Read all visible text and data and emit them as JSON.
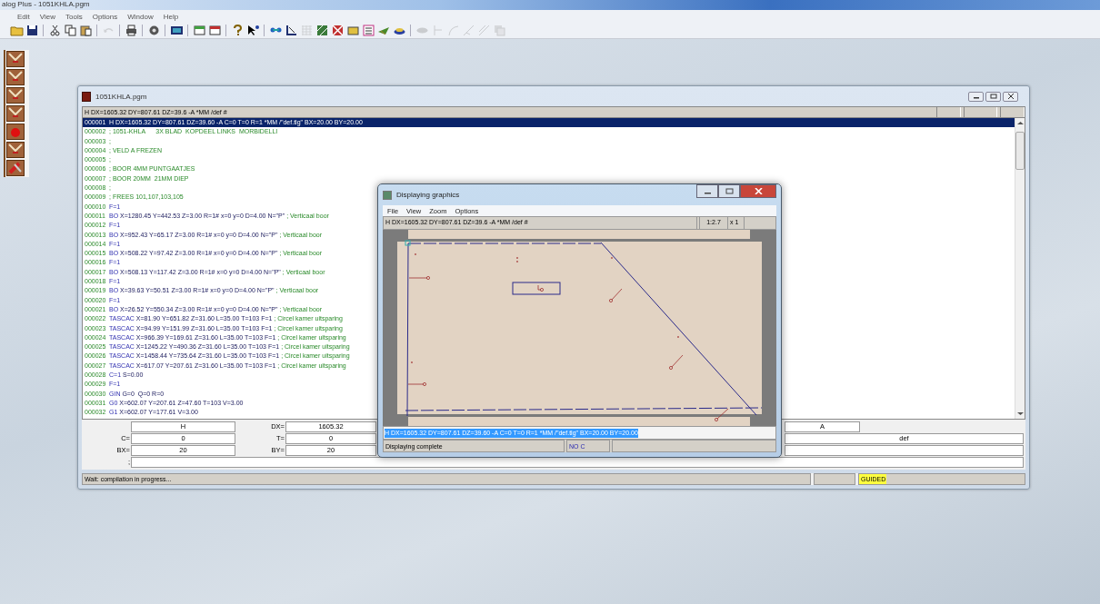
{
  "app": {
    "title": "alog Plus - 1051KHLA.pgm"
  },
  "menu": [
    "Edit",
    "View",
    "Tools",
    "Options",
    "Window",
    "Help"
  ],
  "toolbar": [
    [
      {
        "disabled": false
      },
      {
        "disabled": false
      }
    ],
    [
      {
        "disabled": false
      },
      {
        "disabled": false
      },
      {
        "disabled": false
      }
    ],
    [
      {
        "disabled": true
      }
    ],
    [
      {
        "disabled": false
      }
    ],
    [
      {
        "disabled": false
      }
    ],
    [
      {
        "disabled": false
      }
    ],
    [
      {
        "disabled": false
      },
      {
        "disabled": false
      }
    ],
    [
      {
        "disabled": false
      },
      {
        "disabled": false
      }
    ],
    [
      {
        "disabled": false
      },
      {
        "disabled": false
      },
      {
        "disabled": true
      },
      {
        "disabled": false
      },
      {
        "disabled": false
      },
      {
        "disabled": false
      },
      {
        "disabled": false
      },
      {
        "disabled": false
      },
      {
        "disabled": false
      }
    ],
    [
      {
        "disabled": true
      },
      {
        "disabled": true
      },
      {
        "disabled": true
      },
      {
        "disabled": true
      },
      {
        "disabled": true
      },
      {
        "disabled": true
      }
    ]
  ],
  "side_tools": [
    {
      "kind": "chevron"
    },
    {
      "kind": "chevron"
    },
    {
      "kind": "chevron"
    },
    {
      "kind": "chevron"
    },
    {
      "kind": "dot"
    },
    {
      "kind": "chevron"
    },
    {
      "kind": "tools"
    }
  ],
  "editor": {
    "title": "1051KHLA.pgm",
    "header": "H DX=1605.32 DY=807.61 DZ=39.6 -A *MM /def #",
    "lines": [
      {
        "number": "000001",
        "keyword": "H",
        "args": "DX=1605.32 DY=807.61 DZ=39.60 -A C=0 T=0 R=1 *MM /\"def.tlg\" BX=20.00 BY=20.00",
        "selected": true
      },
      {
        "number": "000002",
        "comment": "; 1051-KHLA      3X BLAD  KOPDEEL LINKS  MORBIDELLI",
        "selected": false
      },
      {
        "number": "000003",
        "comment": ";",
        "selected": false
      },
      {
        "number": "000004",
        "comment": "; VELD A FREZEN",
        "selected": false
      },
      {
        "number": "000005",
        "comment": ";",
        "selected": false
      },
      {
        "number": "000006",
        "comment": "; BOOR 4MM PUNTGAATJES",
        "selected": false
      },
      {
        "number": "000007",
        "comment": "; BOOR 20MM  21MM DIEP",
        "selected": false
      },
      {
        "number": "000008",
        "comment": ";",
        "selected": false
      },
      {
        "number": "000009",
        "comment": "; FREES 101,107,103,105",
        "selected": false
      },
      {
        "number": "000010",
        "keyword": "F=1",
        "selected": false
      },
      {
        "number": "000011",
        "keyword": "BO",
        "args": "X=1280.45 Y=442.53 Z=3.00 R=1# x=0 y=0 D=4.00 N=\"P\"",
        "comment": "; Verticaal boor",
        "selected": false
      },
      {
        "number": "000012",
        "keyword": "F=1",
        "selected": false
      },
      {
        "number": "000013",
        "keyword": "BO",
        "args": "X=952.43 Y=65.17 Z=3.00 R=1# x=0 y=0 D=4.00 N=\"P\"",
        "comment": "; Verticaal boor",
        "selected": false
      },
      {
        "number": "000014",
        "keyword": "F=1",
        "selected": false
      },
      {
        "number": "000015",
        "keyword": "BO",
        "args": "X=508.22 Y=97.42 Z=3.00 R=1# x=0 y=0 D=4.00 N=\"P\"",
        "comment": "; Verticaal boor",
        "selected": false
      },
      {
        "number": "000016",
        "keyword": "F=1",
        "selected": false
      },
      {
        "number": "000017",
        "keyword": "BO",
        "args": "X=508.13 Y=117.42 Z=3.00 R=1# x=0 y=0 D=4.00 N=\"P\"",
        "comment": "; Verticaal boor",
        "selected": false
      },
      {
        "number": "000018",
        "keyword": "F=1",
        "selected": false
      },
      {
        "number": "000019",
        "keyword": "BO",
        "args": "X=39.63 Y=50.51 Z=3.00 R=1# x=0 y=0 D=4.00 N=\"P\"",
        "comment": "; Verticaal boor",
        "selected": false
      },
      {
        "number": "000020",
        "keyword": "F=1",
        "selected": false
      },
      {
        "number": "000021",
        "keyword": "BO",
        "args": "X=26.52 Y=550.34 Z=3.00 R=1# x=0 y=0 D=4.00 N=\"P\"",
        "comment": "; Verticaal boor",
        "selected": false
      },
      {
        "number": "000022",
        "keyword": "TASCAC",
        "args": "X=81.90 Y=651.82 Z=31.60 L=35.00 T=103 F=1",
        "comment": "; Circel kamer uitsparing",
        "selected": false
      },
      {
        "number": "000023",
        "keyword": "TASCAC",
        "args": "X=94.99 Y=151.99 Z=31.60 L=35.00 T=103 F=1",
        "comment": "; Circel kamer uitsparing",
        "selected": false
      },
      {
        "number": "000024",
        "keyword": "TASCAC",
        "args": "X=966.39 Y=169.61 Z=31.60 L=35.00 T=103 F=1",
        "comment": "; Circel kamer uitsparing",
        "selected": false
      },
      {
        "number": "000025",
        "keyword": "TASCAC",
        "args": "X=1245.22 Y=490.36 Z=31.60 L=35.00 T=103 F=1",
        "comment": "; Circel kamer uitsparing",
        "selected": false
      },
      {
        "number": "000026",
        "keyword": "TASCAC",
        "args": "X=1458.44 Y=735.64 Z=31.60 L=35.00 T=103 F=1",
        "comment": "; Circel kamer uitsparing",
        "selected": false
      },
      {
        "number": "000027",
        "keyword": "TASCAC",
        "args": "X=617.07 Y=207.61 Z=31.60 L=35.00 T=103 F=1",
        "comment": "; Circel kamer uitsparing",
        "selected": false
      },
      {
        "number": "000028",
        "keyword": "C=1",
        "args": "S=0.00",
        "selected": false
      },
      {
        "number": "000029",
        "keyword": "F=1",
        "selected": false
      },
      {
        "number": "000030",
        "keyword": "GIN",
        "args": "G=0  Q=0 R=0",
        "selected": false
      },
      {
        "number": "000031",
        "keyword": "G0",
        "args": "X=602.07 Y=207.61 Z=47.60 T=103 V=3.00",
        "selected": false
      },
      {
        "number": "000032",
        "keyword": "G1",
        "args": "X=602.07 Y=177.61 V=3.00",
        "selected": false
      }
    ],
    "fields": [
      [
        {
          "kind": "short",
          "value": "H"
        },
        {
          "kind": "short",
          "label": "DX=",
          "value": "1605.32"
        },
        {
          "kind": "right",
          "value": "A"
        }
      ],
      [
        {
          "kind": "short",
          "label": "C=",
          "value": "0"
        },
        {
          "kind": "short",
          "label": "T=",
          "value": "0"
        },
        {
          "kind": "wide",
          "value": "def"
        }
      ],
      [
        {
          "kind": "short",
          "label": "BX=",
          "value": "20"
        },
        {
          "kind": "short",
          "label": "BY=",
          "value": "20"
        },
        {
          "kind": "wide"
        }
      ]
    ],
    "comment_field": {
      "label": ";"
    },
    "status": {
      "message": "Wait: compilation in progress...",
      "mode": "GUIDED"
    }
  },
  "graphics": {
    "title": "Displaying graphics",
    "menu": [
      "File",
      "View",
      "Zoom",
      "Options"
    ],
    "header": "H DX=1605.32 DY=807.61 DZ=39.6 -A *MM /def #",
    "scale": "1:2.7",
    "zoom": "x 1",
    "selected_line": "H DX=1605.32 DY=807.61 DZ=39.60 -A C=0 T=0 R=1 *MM /\"def.tlg\" BX=20.00 BY=20.00",
    "status": "Displaying complete",
    "mode": "NO C"
  }
}
